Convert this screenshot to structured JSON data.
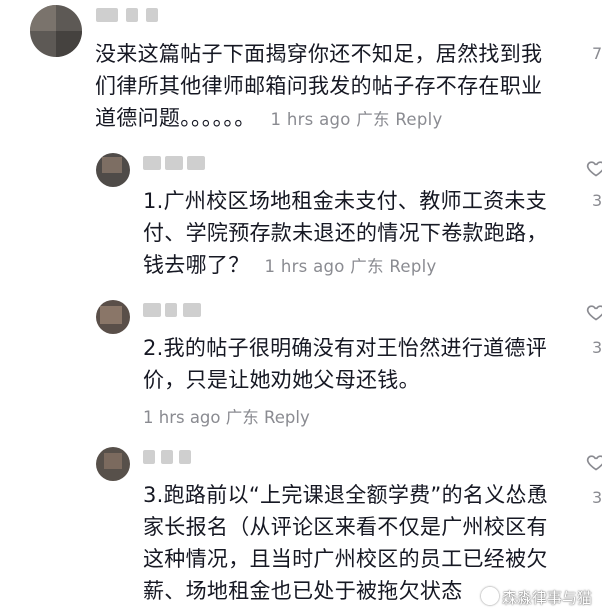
{
  "comments": [
    {
      "body": "没来这篇帖子下面揭穿你还不知足，居然找到我们律所其他律师邮箱问我发的帖子存不存在职业道德问题。。。。。。",
      "time": "1 hrs ago",
      "location": "广东",
      "reply": "Reply",
      "likes": "7"
    },
    {
      "body": "1.广州校区场地租金未支付、教师工资未支付、学院预存款未退还的情况下卷款跑路，钱去哪了？",
      "time": "1 hrs ago",
      "location": "广东",
      "reply": "Reply",
      "likes": "3"
    },
    {
      "body": "2.我的帖子很明确没有对王怡然进行道德评价，只是让她劝她父母还钱。",
      "time": "1 hrs ago",
      "location": "广东",
      "reply": "Reply",
      "likes": "3"
    },
    {
      "body": "3.跑路前以“上完课退全额学费”的名义怂恿家长报名（从评论区来看不仅是广州校区有这种情况，且当时广州校区的员工已经被欠薪、场地租金也已处于被拖欠状态",
      "likes": "3"
    }
  ],
  "watermark": "森淼律事与猫",
  "colors": {
    "text": "#161823",
    "meta": "#8a8b91"
  }
}
